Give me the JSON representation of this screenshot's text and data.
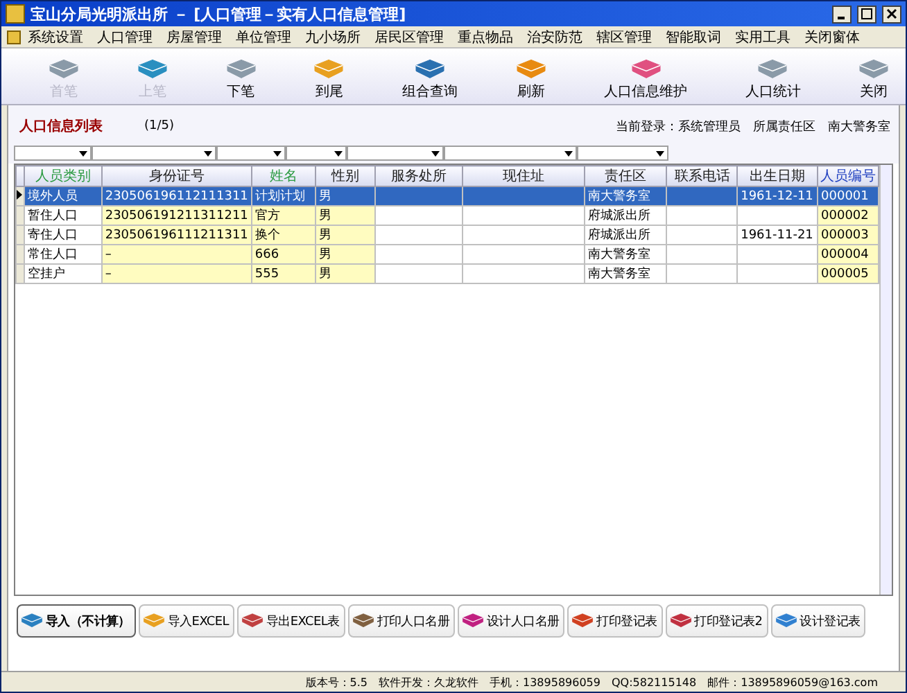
{
  "window": {
    "title": "宝山分局光明派出所 － [人口管理－实有人口信息管理]"
  },
  "menu": [
    "系统设置",
    "人口管理",
    "房屋管理",
    "单位管理",
    "九小场所",
    "居民区管理",
    "重点物品",
    "治安防范",
    "辖区管理",
    "智能取词",
    "实用工具",
    "关闭窗体"
  ],
  "toolbar": [
    {
      "label": "首笔",
      "disabled": true,
      "color": "#8a9aa8"
    },
    {
      "label": "上笔",
      "disabled": true,
      "color": "#2a8fc0"
    },
    {
      "label": "下笔",
      "disabled": false,
      "color": "#8a9aa8"
    },
    {
      "label": "到尾",
      "disabled": false,
      "color": "#e8a020"
    },
    {
      "label": "组合查询",
      "disabled": false,
      "color": "#2a70b0"
    },
    {
      "label": "刷新",
      "disabled": false,
      "color": "#e88a10"
    },
    {
      "label": "人口信息维护",
      "disabled": false,
      "color": "#e05080"
    },
    {
      "label": "人口统计",
      "disabled": false,
      "color": "#8a9aa8"
    },
    {
      "label": "关闭",
      "disabled": false,
      "color": "#8a9aa8"
    }
  ],
  "list": {
    "title": "人口信息列表",
    "position": "(1/5)",
    "login": "当前登录：系统管理员　所属责任区　南大警务室"
  },
  "table": {
    "columns": [
      {
        "label": "人员类别",
        "color": "#2a9a40",
        "editable": false
      },
      {
        "label": "身份证号",
        "color": "#202020",
        "editable": true
      },
      {
        "label": "姓名",
        "color": "#2a9a40",
        "editable": true
      },
      {
        "label": "性别",
        "color": "#202020",
        "editable": true
      },
      {
        "label": "服务处所",
        "color": "#202020",
        "editable": false
      },
      {
        "label": "现住址",
        "color": "#202020",
        "editable": false
      },
      {
        "label": "责任区",
        "color": "#202020",
        "editable": false
      },
      {
        "label": "联系电话",
        "color": "#202020",
        "editable": false
      },
      {
        "label": "出生日期",
        "color": "#202020",
        "editable": false
      },
      {
        "label": "人员编号",
        "color": "#2040c0",
        "editable": true
      }
    ],
    "rows": [
      {
        "selected": true,
        "cells": [
          "境外人员",
          "230506196112111311",
          "计划计划",
          "男",
          "",
          "",
          "南大警务室",
          "",
          "1961-12-11",
          "000001"
        ]
      },
      {
        "selected": false,
        "cells": [
          "暂住人口",
          "230506191211311211",
          "官方",
          "男",
          "",
          "",
          "府城派出所",
          "",
          "",
          "000002"
        ]
      },
      {
        "selected": false,
        "cells": [
          "寄住人口",
          "230506196111211311",
          "换个",
          "男",
          "",
          "",
          "府城派出所",
          "",
          "1961-11-21",
          "000003"
        ]
      },
      {
        "selected": false,
        "cells": [
          "常住人口",
          "–",
          "666",
          "男",
          "",
          "",
          "南大警务室",
          "",
          "",
          "000004"
        ]
      },
      {
        "selected": false,
        "cells": [
          "空挂户",
          "–",
          "555",
          "男",
          "",
          "",
          "南大警务室",
          "",
          "",
          "000005"
        ]
      }
    ]
  },
  "actions": [
    {
      "label": "导入（不计算）",
      "selected": true,
      "color": "#2a80c0"
    },
    {
      "label": "导入EXCEL",
      "selected": false,
      "color": "#e8a020"
    },
    {
      "label": "导出EXCEL表",
      "selected": false,
      "color": "#c04040"
    },
    {
      "label": "打印人口名册",
      "selected": false,
      "color": "#806040"
    },
    {
      "label": "设计人口名册",
      "selected": false,
      "color": "#c02080"
    },
    {
      "label": "打印登记表",
      "selected": false,
      "color": "#d04020"
    },
    {
      "label": "打印登记表2",
      "selected": false,
      "color": "#c03040"
    },
    {
      "label": "设计登记表",
      "selected": false,
      "color": "#3080d0"
    }
  ],
  "status_bar": [
    "版本号：5.5",
    "软件开发：久龙软件",
    "手机：13895896059",
    "QQ:582115148",
    "邮件：13895896059@163.com"
  ]
}
